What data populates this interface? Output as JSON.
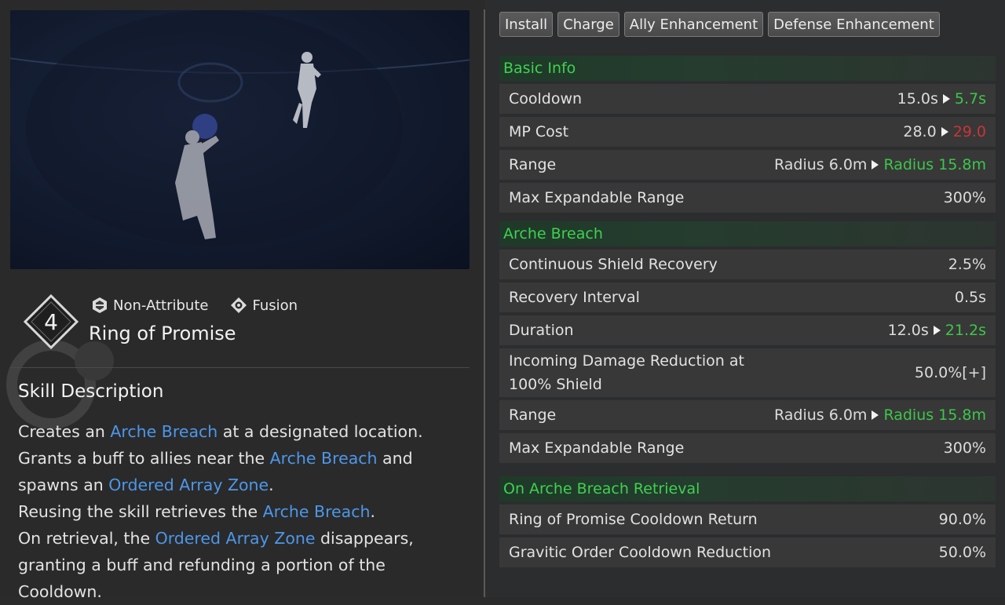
{
  "skill": {
    "tier": "4",
    "attribute": "Non-Attribute",
    "type": "Fusion",
    "name": "Ring of Promise"
  },
  "description": {
    "title": "Skill Description",
    "parts": [
      {
        "t": "Creates an "
      },
      {
        "t": "Arche Breach",
        "kw": true
      },
      {
        "t": " at a designated location."
      },
      {
        "br": true
      },
      {
        "t": "Grants a buff to allies near the "
      },
      {
        "t": "Arche Breach",
        "kw": true
      },
      {
        "t": " and"
      },
      {
        "br": true
      },
      {
        "t": "spawns an "
      },
      {
        "t": "Ordered Array Zone",
        "kw": true
      },
      {
        "t": "."
      },
      {
        "br": true
      },
      {
        "t": "Reusing the skill retrieves the "
      },
      {
        "t": "Arche Breach",
        "kw": true
      },
      {
        "t": "."
      },
      {
        "br": true
      },
      {
        "t": "On retrieval, the "
      },
      {
        "t": "Ordered Array Zone",
        "kw": true
      },
      {
        "t": " disappears,"
      },
      {
        "br": true
      },
      {
        "t": "granting a buff and refunding a portion of the"
      },
      {
        "br": true
      },
      {
        "t": "Cooldown."
      }
    ]
  },
  "tabs": [
    "Install",
    "Charge",
    "Ally Enhancement",
    "Defense Enhancement"
  ],
  "sections": {
    "basic": {
      "title": "Basic Info",
      "rows": [
        {
          "label": "Cooldown",
          "from": "15.0s",
          "to": "5.7s",
          "to_color": "green"
        },
        {
          "label": "MP Cost",
          "from": "28.0",
          "to": "29.0",
          "to_color": "red"
        },
        {
          "label": "Range",
          "from": "Radius 6.0m",
          "to": "Radius 15.8m",
          "to_color": "green"
        },
        {
          "label": "Max Expandable Range",
          "value": "300%"
        }
      ]
    },
    "breach": {
      "title": "Arche Breach",
      "rows": [
        {
          "label": "Continuous Shield Recovery",
          "value": "2.5%"
        },
        {
          "label": "Recovery Interval",
          "value": "0.5s"
        },
        {
          "label": "Duration",
          "from": "12.0s",
          "to": "21.2s",
          "to_color": "green"
        },
        {
          "label": "Incoming Damage Reduction at\n100% Shield",
          "value": "50.0%[+]"
        },
        {
          "label": "Range",
          "from": "Radius 6.0m",
          "to": "Radius 15.8m",
          "to_color": "green"
        },
        {
          "label": "Max Expandable Range",
          "value": "300%"
        }
      ]
    },
    "retrieval": {
      "title": "On Arche Breach Retrieval",
      "rows": [
        {
          "label": "Ring of Promise Cooldown Return",
          "value": "90.0%"
        },
        {
          "label": "Gravitic Order Cooldown Reduction",
          "value": "50.0%"
        }
      ]
    }
  },
  "colors": {
    "green": "#3cc64b",
    "red": "#c8353a",
    "keyword": "#4d97e8",
    "section": "#3fd14f"
  }
}
